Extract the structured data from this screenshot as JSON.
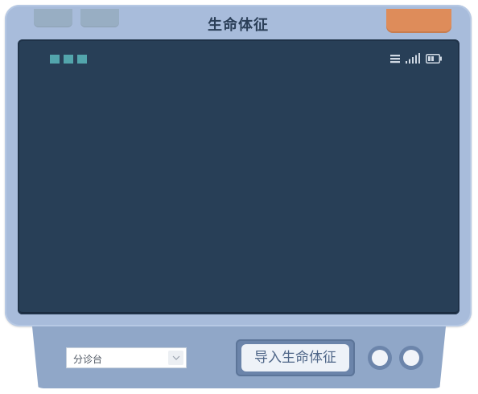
{
  "window": {
    "title": "生命体征"
  },
  "colors": {
    "device_frame": "#a8bcdb",
    "screen": "#283f57",
    "accent_power": "#de8c5a",
    "indicator": "#53a5ac",
    "base": "#90a7c8"
  },
  "screen": {
    "indicator_count": 3,
    "status_icons": [
      "menu-icon",
      "signal-icon",
      "battery-icon"
    ]
  },
  "controls": {
    "triage_select": {
      "value": "分诊台"
    },
    "import_button": {
      "label": "导入生命体征"
    }
  }
}
